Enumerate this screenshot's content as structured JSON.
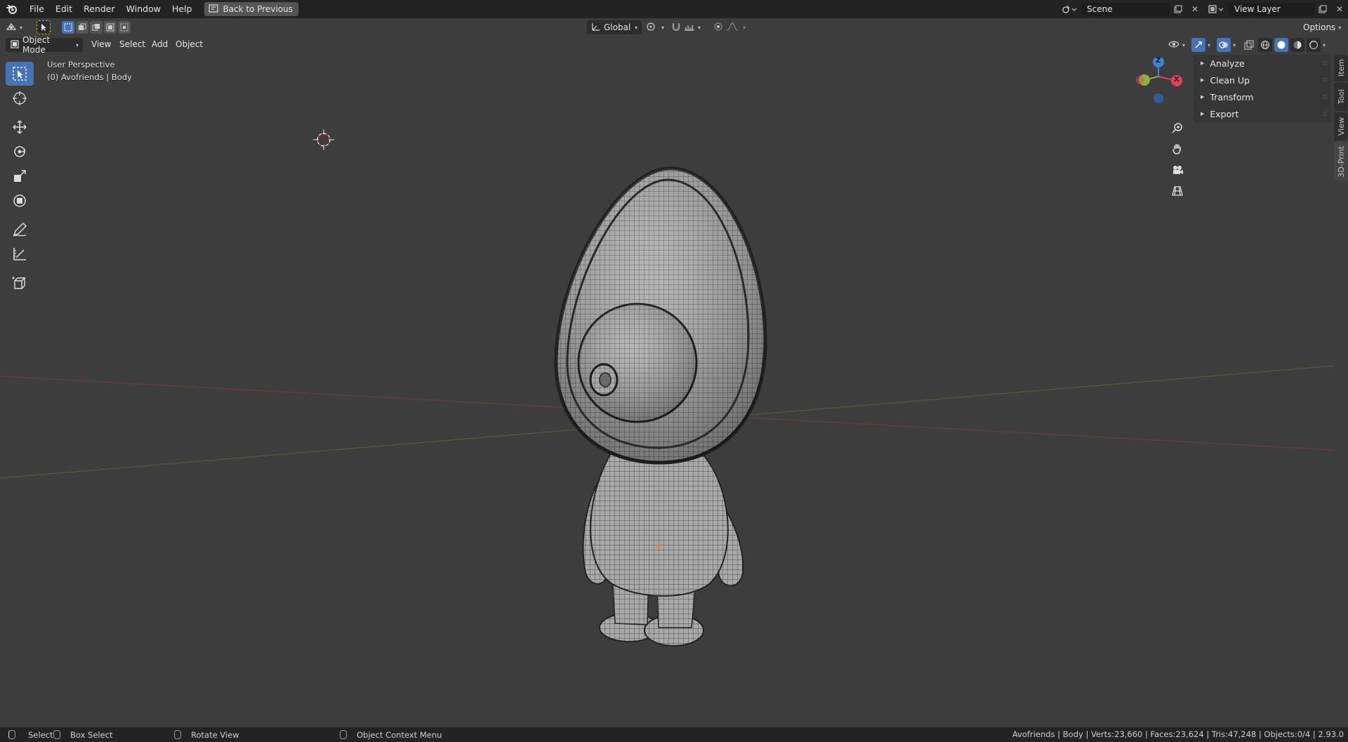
{
  "menubar": {
    "items": [
      "File",
      "Edit",
      "Render",
      "Window",
      "Help"
    ],
    "back_button": "Back to Previous",
    "scene": "Scene",
    "view_layer": "View Layer"
  },
  "header": {
    "transform_orientation": "Global",
    "options_label": "Options",
    "mode": "Object Mode",
    "menus": [
      "View",
      "Select",
      "Add",
      "Object"
    ]
  },
  "viewport": {
    "perspective": "User Perspective",
    "object_info": "(0) Avofriends | Body",
    "axis_labels": {
      "z": "Z",
      "x": "X"
    }
  },
  "sidebar": {
    "panels": [
      "Analyze",
      "Clean Up",
      "Transform",
      "Export"
    ],
    "tabs": [
      "Item",
      "Tool",
      "View",
      "3D-Print"
    ],
    "active_tab": "3D-Print"
  },
  "statusbar": {
    "select": "Select",
    "box_select": "Box Select",
    "rotate_view": "Rotate View",
    "context_menu": "Object Context Menu",
    "stats": "Avofriends | Body | Verts:23,660 | Faces:23,624 | Tris:47,248 | Objects:0/4 | 2.93.0"
  },
  "colors": {
    "accent": "#4772b3",
    "x_axis": "#e0445a",
    "y_axis": "#88b43c",
    "z_axis": "#3a83d6"
  }
}
